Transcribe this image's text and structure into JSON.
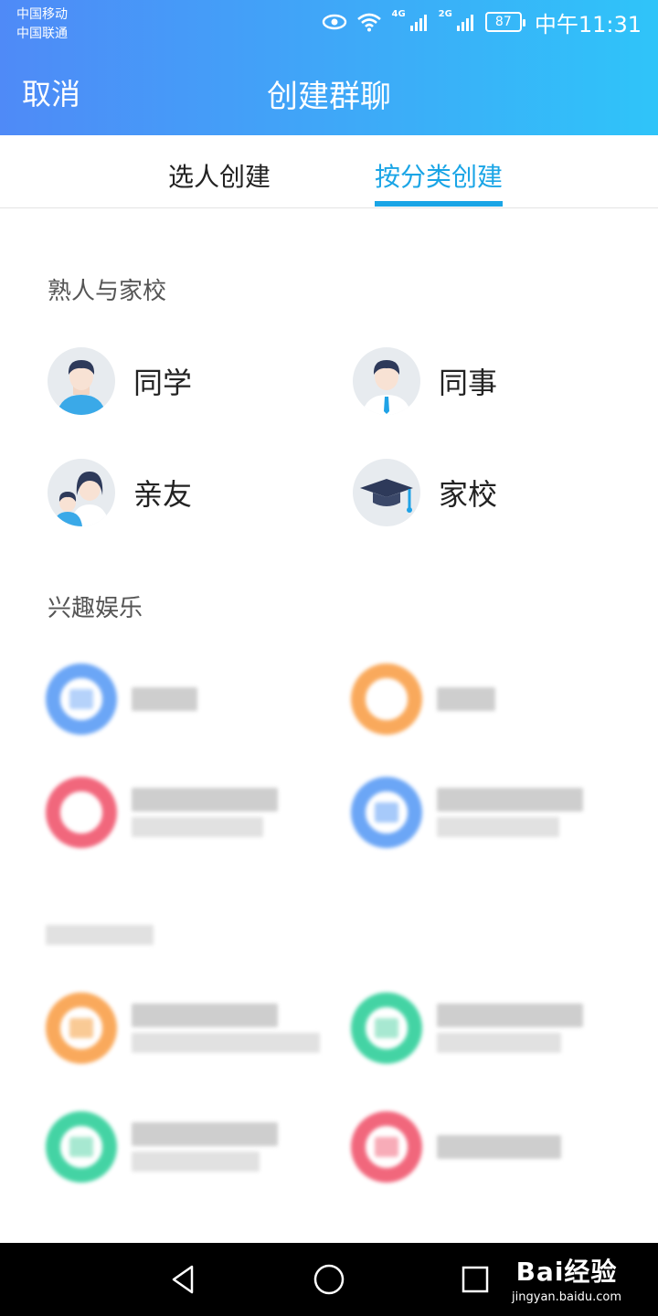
{
  "status_bar": {
    "carrier1": "中国移动",
    "carrier2": "中国联通",
    "net1": "4G",
    "net2": "2G",
    "battery": "87",
    "time": "中午11:31"
  },
  "nav": {
    "cancel": "取消",
    "title": "创建群聊"
  },
  "tabs": [
    {
      "label": "选人创建",
      "active": false
    },
    {
      "label": "按分类创建",
      "active": true
    }
  ],
  "sections": {
    "acquaintances": {
      "title": "熟人与家校",
      "items": [
        {
          "label": "同学",
          "icon": "student-avatar-icon"
        },
        {
          "label": "同事",
          "icon": "colleague-avatar-icon"
        },
        {
          "label": "亲友",
          "icon": "family-avatar-icon"
        },
        {
          "label": "家校",
          "icon": "graduation-cap-icon"
        }
      ]
    },
    "interest": {
      "title": "兴趣娱乐"
    }
  },
  "colors": {
    "accent": "#1aa5e6",
    "header_left": "#4f8af7",
    "header_right": "#2fc4f9",
    "blue_ring": "#5b9cf5",
    "orange_ring": "#f9a04a",
    "red_ring": "#f0566e",
    "green_ring": "#2fcf9a"
  },
  "watermark": {
    "main": "Bai经验",
    "sub": "jingyan.baidu.com"
  }
}
